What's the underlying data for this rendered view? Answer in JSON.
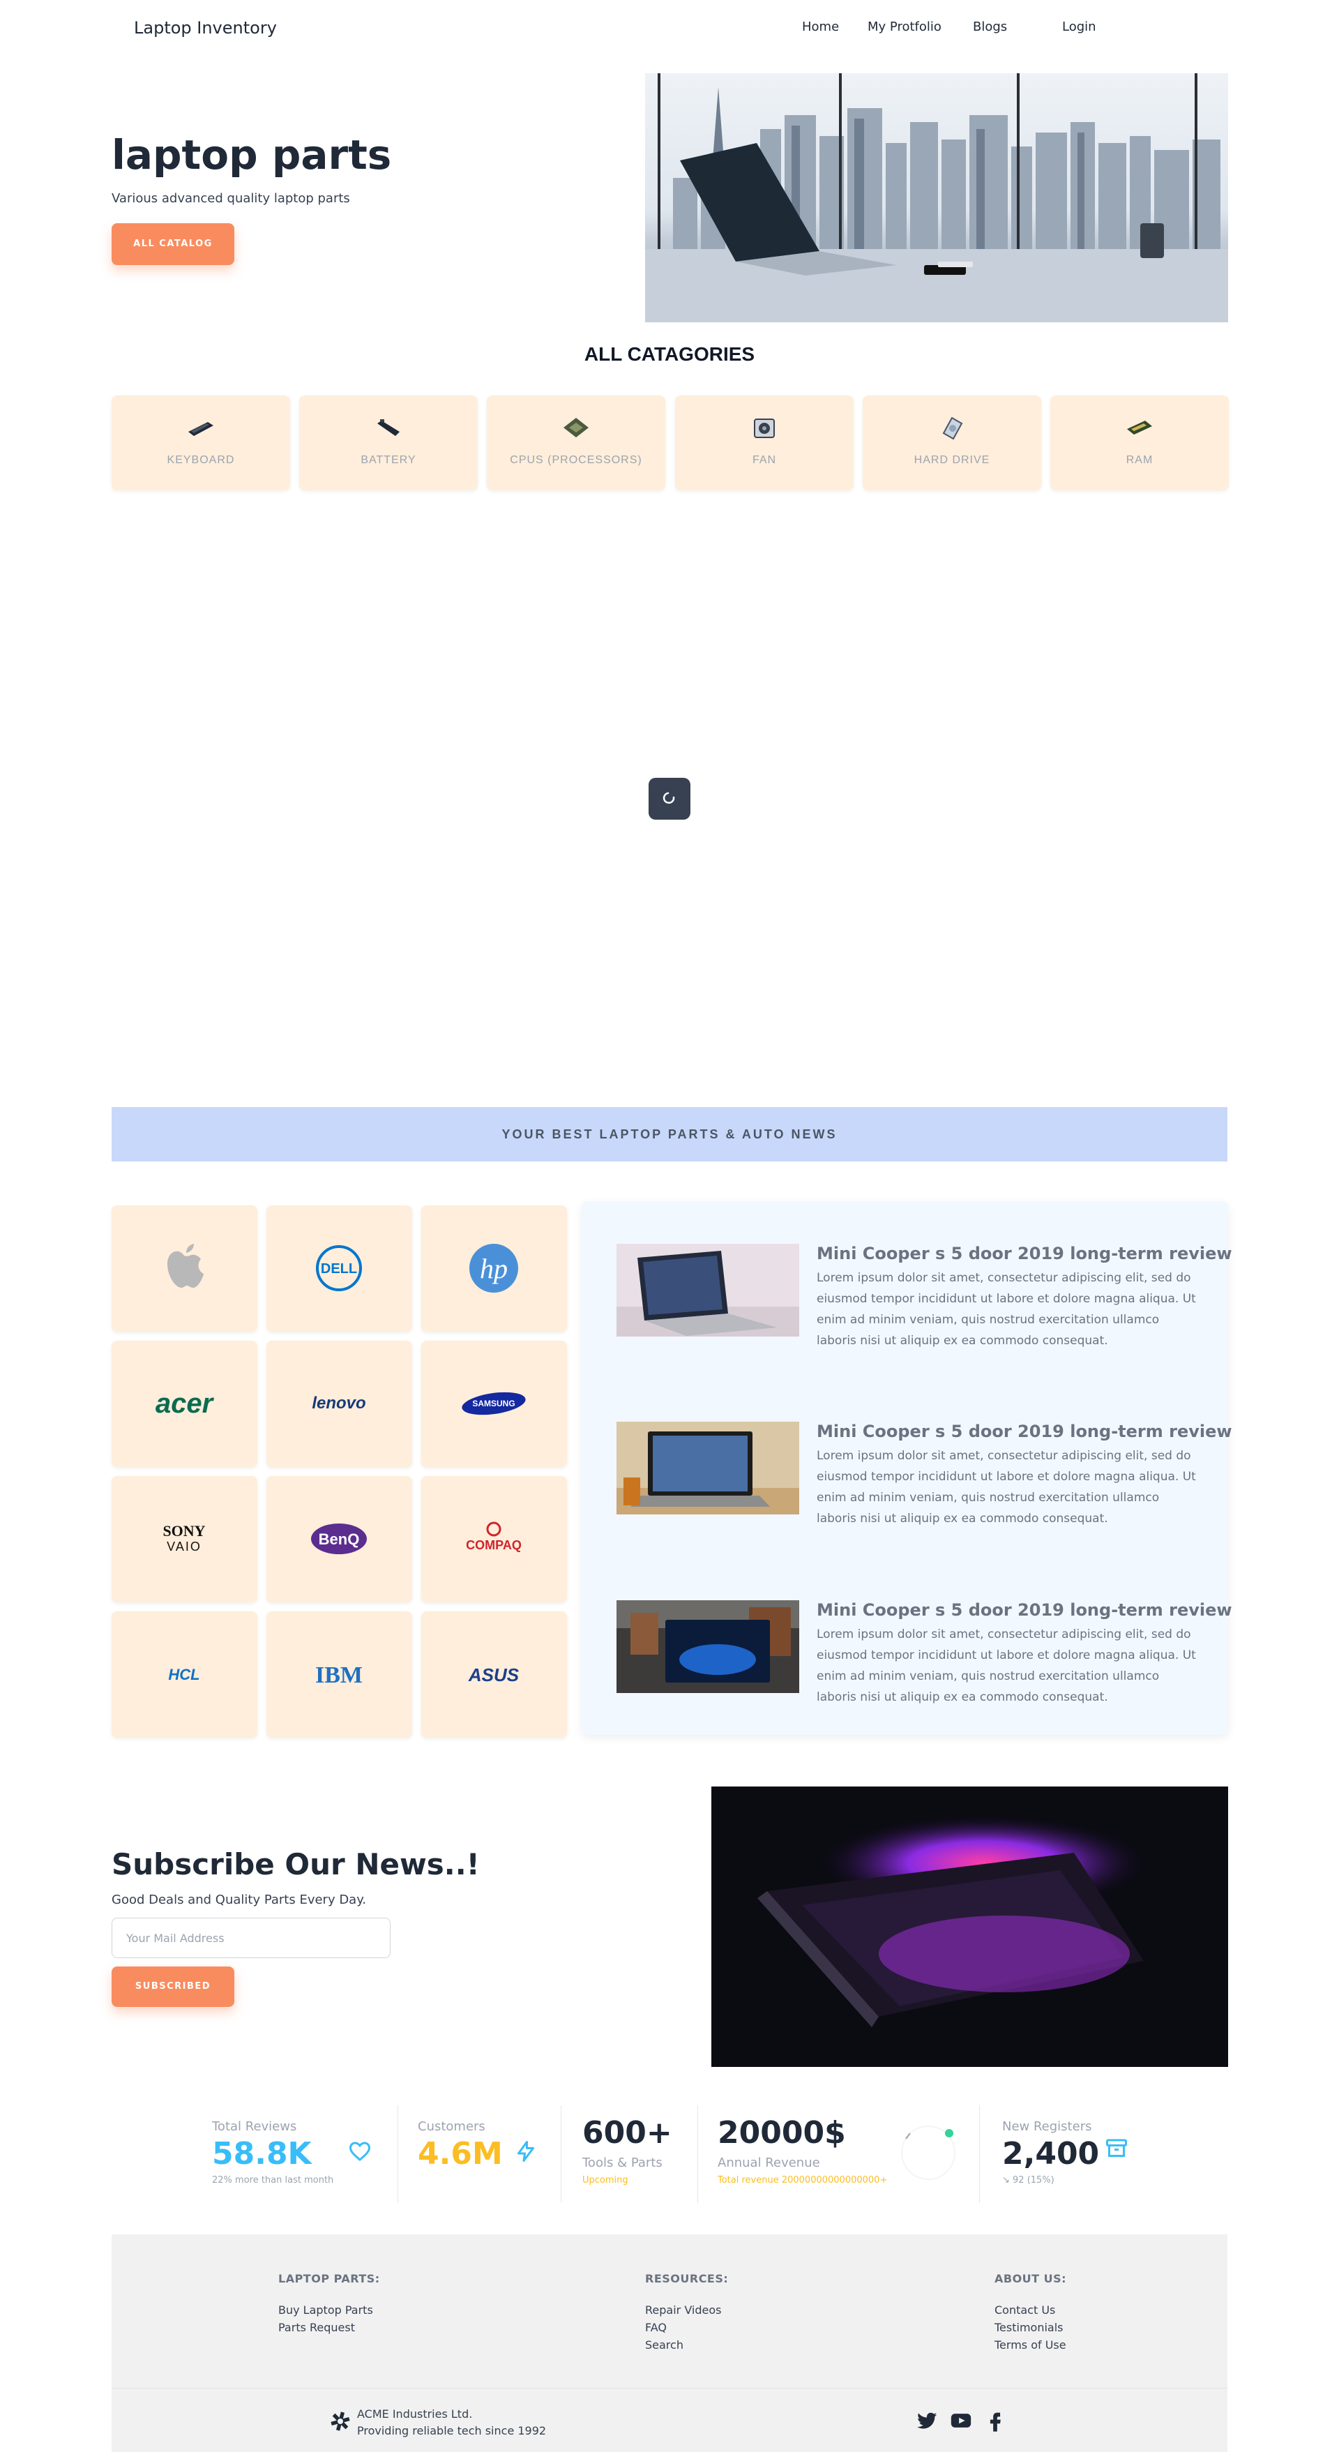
{
  "navbar": {
    "brand": "Laptop Inventory",
    "links": [
      "Home",
      "My Protfolio",
      "Blogs",
      "Login"
    ]
  },
  "hero": {
    "title": "laptop parts",
    "subtitle": "Various advanced quality laptop parts",
    "button": "ALL CATALOG"
  },
  "categories": {
    "title": "ALL CATAGORIES",
    "items": [
      {
        "label": "KEYBOARD",
        "icon": "keyboard-icon"
      },
      {
        "label": "BATTERY",
        "icon": "battery-icon"
      },
      {
        "label": "CPUS (PROCESSORS)",
        "icon": "cpu-icon"
      },
      {
        "label": "FAN",
        "icon": "fan-icon"
      },
      {
        "label": "HARD DRIVE",
        "icon": "hard-drive-icon"
      },
      {
        "label": "RAM",
        "icon": "ram-icon"
      }
    ]
  },
  "news_banner": "YOUR BEST LAPTOP PARTS & AUTO NEWS",
  "brands": {
    "dell": "DELL",
    "hp": "hp",
    "acer": "acer",
    "lenovo": "lenovo",
    "samsung": "SAMSUNG",
    "sony": "SONY",
    "vaio": "VAIO",
    "benq": "BenQ",
    "compaq": "COMPAQ",
    "hcl": "HCL",
    "ibm": "IBM",
    "asus": "ASUS"
  },
  "news": [
    {
      "title": "Mini Cooper s 5 door 2019 long-term review",
      "body": "Lorem ipsum dolor sit amet, consectetur adipiscing elit, sed do eiusmod tempor incididunt ut labore et dolore magna aliqua. Ut enim ad minim veniam, quis nostrud exercitation ullamco laboris nisi ut aliquip ex ea commodo consequat."
    },
    {
      "title": "Mini Cooper s 5 door 2019 long-term review",
      "body": "Lorem ipsum dolor sit amet, consectetur adipiscing elit, sed do eiusmod tempor incididunt ut labore et dolore magna aliqua. Ut enim ad minim veniam, quis nostrud exercitation ullamco laboris nisi ut aliquip ex ea commodo consequat."
    },
    {
      "title": "Mini Cooper s 5 door 2019 long-term review",
      "body": "Lorem ipsum dolor sit amet, consectetur adipiscing elit, sed do eiusmod tempor incididunt ut labore et dolore magna aliqua. Ut enim ad minim veniam, quis nostrud exercitation ullamco laboris nisi ut aliquip ex ea commodo consequat."
    }
  ],
  "subscribe": {
    "title": "Subscribe Our News..!",
    "subtitle": "Good Deals and Quality Parts Every Day.",
    "placeholder": "Your Mail Address",
    "button": "SUBSCRIBED"
  },
  "stats": {
    "reviews": {
      "title": "Total Reviews",
      "value": "58.8K",
      "desc": "22% more than last month",
      "icon": "heart-icon"
    },
    "customers": {
      "title": "Customers",
      "value": "4.6M",
      "icon": "bolt-icon"
    },
    "tools": {
      "value": "600+",
      "title": "Tools & Parts",
      "desc": "Upcoming"
    },
    "revenue": {
      "value": "20000$",
      "title": "Annual Revenue",
      "desc": "Total revenue 20000000000000000+"
    },
    "registers": {
      "title": "New Registers",
      "value": "2,400",
      "desc": "↘ 92 (15%)",
      "icon": "archive-icon"
    },
    "colors": {
      "blue": "#38bdf8",
      "amber": "#fbbd23",
      "dark": "#1f2937",
      "green": "#34d399"
    }
  },
  "footer": {
    "col1": {
      "title": "LAPTOP PARTS:",
      "links": [
        "Buy Laptop Parts",
        "Parts Request"
      ]
    },
    "col2": {
      "title": "RESOURCES:",
      "links": [
        "Repair Videos",
        "FAQ",
        "Search"
      ]
    },
    "col3": {
      "title": "ABOUT US:",
      "links": [
        "Contact Us",
        "Testimonials",
        "Terms of Use"
      ]
    },
    "company": "ACME Industries Ltd.",
    "tagline": "Providing reliable tech since 1992",
    "social": [
      "twitter-icon",
      "youtube-icon",
      "facebook-icon"
    ]
  }
}
